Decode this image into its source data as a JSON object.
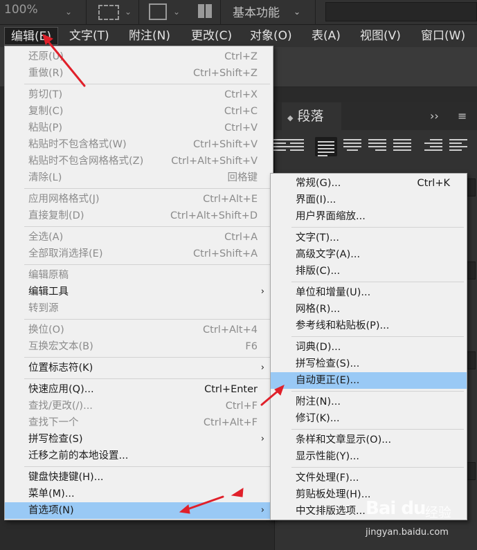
{
  "control_bar": {
    "zoom": "100%",
    "workspace": "基本功能"
  },
  "menu_bar": [
    {
      "label": "编辑(E)",
      "open": true
    },
    {
      "label": "文字(T)"
    },
    {
      "label": "附注(N)"
    },
    {
      "label": "更改(C)"
    },
    {
      "label": "对象(O)"
    },
    {
      "label": "表(A)"
    },
    {
      "label": "视图(V)"
    },
    {
      "label": "窗口(W)"
    }
  ],
  "paragraph_panel": {
    "tab_label": "段落",
    "collapse_label": "››",
    "menu_label": "≡"
  },
  "edit_menu": {
    "items": [
      {
        "label": "还原(U)",
        "shortcut": "Ctrl+Z",
        "disabled": true
      },
      {
        "label": "重做(R)",
        "shortcut": "Ctrl+Shift+Z",
        "disabled": true
      },
      {
        "label": "剪切(T)",
        "shortcut": "Ctrl+X",
        "disabled": true
      },
      {
        "label": "复制(C)",
        "shortcut": "Ctrl+C",
        "disabled": true
      },
      {
        "label": "粘贴(P)",
        "shortcut": "Ctrl+V",
        "disabled": true
      },
      {
        "label": "粘贴时不包含格式(W)",
        "shortcut": "Ctrl+Shift+V",
        "disabled": true
      },
      {
        "label": "粘贴时不包含网格格式(Z)",
        "shortcut": "Ctrl+Alt+Shift+V",
        "disabled": true
      },
      {
        "label": "清除(L)",
        "shortcut": "回格键",
        "disabled": true
      },
      {
        "label": "应用网格格式(J)",
        "shortcut": "Ctrl+Alt+E",
        "disabled": true
      },
      {
        "label": "直接复制(D)",
        "shortcut": "Ctrl+Alt+Shift+D",
        "disabled": true
      },
      {
        "label": "全选(A)",
        "shortcut": "Ctrl+A",
        "disabled": true
      },
      {
        "label": "全部取消选择(E)",
        "shortcut": "Ctrl+Shift+A",
        "disabled": true
      },
      {
        "label": "编辑原稿",
        "shortcut": "",
        "disabled": true
      },
      {
        "label": "编辑工具",
        "shortcut": "",
        "submenu": true
      },
      {
        "label": "转到源",
        "shortcut": "",
        "disabled": true
      },
      {
        "label": "换位(O)",
        "shortcut": "Ctrl+Alt+4",
        "disabled": true
      },
      {
        "label": "互换宏文本(B)",
        "shortcut": "F6",
        "disabled": true
      },
      {
        "label": "位置标志符(K)",
        "shortcut": "",
        "submenu": true
      },
      {
        "label": "快速应用(Q)...",
        "shortcut": "Ctrl+Enter"
      },
      {
        "label": "查找/更改(/)...",
        "shortcut": "Ctrl+F",
        "disabled": true
      },
      {
        "label": "查找下一个",
        "shortcut": "Ctrl+Alt+F",
        "disabled": true
      },
      {
        "label": "拼写检查(S)",
        "shortcut": "",
        "submenu": true
      },
      {
        "label": "迁移之前的本地设置...",
        "shortcut": ""
      },
      {
        "label": "键盘快捷键(H)...",
        "shortcut": ""
      },
      {
        "label": "菜单(M)...",
        "shortcut": ""
      },
      {
        "label": "首选项(N)",
        "shortcut": "",
        "submenu": true,
        "highlighted": true
      }
    ]
  },
  "preferences_submenu": {
    "items": [
      {
        "label": "常规(G)...",
        "shortcut": "Ctrl+K"
      },
      {
        "label": "界面(I)...",
        "shortcut": ""
      },
      {
        "label": "用户界面缩放...",
        "shortcut": ""
      },
      {
        "label": "文字(T)...",
        "shortcut": ""
      },
      {
        "label": "高级文字(A)...",
        "shortcut": ""
      },
      {
        "label": "排版(C)...",
        "shortcut": ""
      },
      {
        "label": "单位和增量(U)...",
        "shortcut": ""
      },
      {
        "label": "网格(R)...",
        "shortcut": ""
      },
      {
        "label": "参考线和粘贴板(P)...",
        "shortcut": ""
      },
      {
        "label": "词典(D)...",
        "shortcut": ""
      },
      {
        "label": "拼写检查(S)...",
        "shortcut": ""
      },
      {
        "label": "自动更正(E)...",
        "shortcut": "",
        "highlighted": true
      },
      {
        "label": "附注(N)...",
        "shortcut": ""
      },
      {
        "label": "修订(K)...",
        "shortcut": ""
      },
      {
        "label": "条样和文章显示(O)...",
        "shortcut": ""
      },
      {
        "label": "显示性能(Y)...",
        "shortcut": ""
      },
      {
        "label": "文件处理(F)...",
        "shortcut": ""
      },
      {
        "label": "剪贴板处理(H)...",
        "shortcut": ""
      },
      {
        "label": "中文排版选项...",
        "shortcut": ""
      }
    ]
  },
  "watermark": {
    "logo": "Bai du",
    "brand_cn": "经验",
    "url": "jingyan.baidu.com"
  },
  "colors": {
    "menu_bg": "#f0f0f0",
    "highlight": "#99c9f5",
    "annotation_arrow": "#e0202a",
    "app_dark": "#323232"
  }
}
